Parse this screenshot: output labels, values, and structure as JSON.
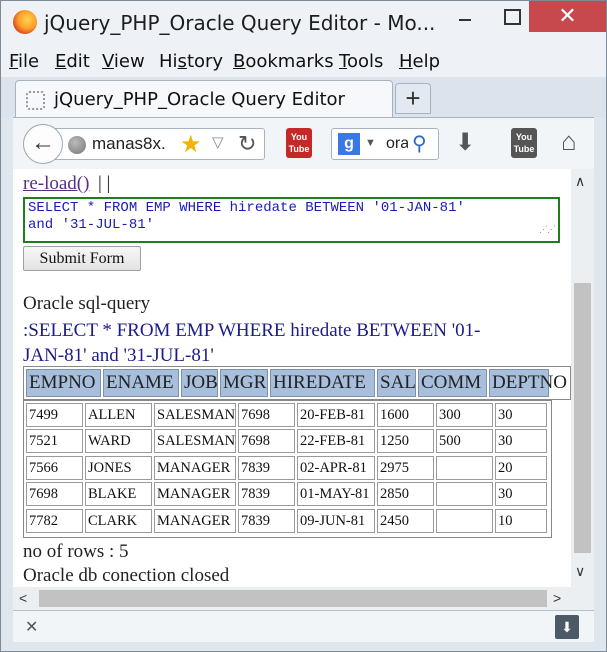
{
  "window": {
    "title": "jQuery_PHP_Oracle Query Editor - Mo...",
    "close_glyph": "✕"
  },
  "menu": {
    "items": [
      {
        "underlined": "F",
        "rest": "ile"
      },
      {
        "underlined": "E",
        "rest": "dit"
      },
      {
        "underlined": "V",
        "rest": "iew"
      },
      {
        "prefix": "Hi",
        "underlined": "s",
        "rest": "tory"
      },
      {
        "underlined": "B",
        "rest": "ookmarks"
      },
      {
        "underlined": "T",
        "rest": "ools"
      },
      {
        "underlined": "H",
        "rest": "elp"
      }
    ]
  },
  "tab": {
    "label": "jQuery_PHP_Oracle Query Editor",
    "new_tab_glyph": "+"
  },
  "navbar": {
    "url": "manas8x.",
    "search_text": "ora",
    "search_engine_icon": "google-icon",
    "icons": [
      "back-arrow-icon",
      "globe-icon",
      "bookmark-star-icon",
      "dropdown-icon",
      "reload-icon",
      "youtube-icon",
      "search-icon",
      "download-icon",
      "youtube-icon",
      "home-icon"
    ]
  },
  "page": {
    "reload_link": "re-load()",
    "reload_suffix": "| |",
    "sql_text": "SELECT * FROM EMP WHERE hiredate BETWEEN '01-JAN-81'\nand '31-JUL-81'",
    "submit_label": "Submit Form",
    "section_title": "Oracle sql-query",
    "query_echo": ":SELECT * FROM EMP WHERE hiredate BETWEEN '01-JAN-81' and '31-JUL-81'",
    "columns": [
      "EMPNO",
      "ENAME",
      "JOB",
      "MGR",
      "HIREDATE",
      "SAL",
      "COMM",
      "DEPTNO"
    ],
    "rows": [
      [
        "7499",
        "ALLEN",
        "SALESMAN",
        "7698",
        "20-FEB-81",
        "1600",
        "300",
        "30"
      ],
      [
        "7521",
        "WARD",
        "SALESMAN",
        "7698",
        "22-FEB-81",
        "1250",
        "500",
        "30"
      ],
      [
        "7566",
        "JONES",
        "MANAGER",
        "7839",
        "02-APR-81",
        "2975",
        "",
        "20"
      ],
      [
        "7698",
        "BLAKE",
        "MANAGER",
        "7839",
        "01-MAY-81",
        "2850",
        "",
        "30"
      ],
      [
        "7782",
        "CLARK",
        "MANAGER",
        "7839",
        "09-JUN-81",
        "2450",
        "",
        "10"
      ]
    ],
    "rows_count": "no of rows : 5",
    "db_closed": "Oracle db conection closed"
  },
  "colors": {
    "header_bg": "#a7bfdc",
    "sql_border": "#1e7d1e",
    "sql_text": "#1b1bbb",
    "close_button": "#c7494e"
  }
}
